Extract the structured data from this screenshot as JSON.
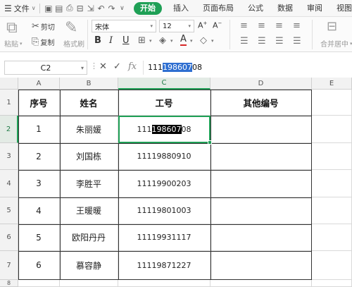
{
  "menubar": {
    "file_label": "文件",
    "tabs": [
      {
        "label": "开始",
        "active": true
      },
      {
        "label": "插入",
        "active": false
      },
      {
        "label": "页面布局",
        "active": false
      },
      {
        "label": "公式",
        "active": false
      },
      {
        "label": "数据",
        "active": false
      },
      {
        "label": "审阅",
        "active": false
      },
      {
        "label": "视图",
        "active": false
      }
    ]
  },
  "ribbon": {
    "cut_label": "剪切",
    "copy_label": "复制",
    "format_painter_label": "格式刷",
    "paste_label": "粘贴",
    "font_name": "宋体",
    "font_size": "12",
    "merge_label": "合并居中"
  },
  "formula_bar": {
    "name_box": "C2",
    "value_prefix": "111",
    "value_selected": "198607",
    "value_suffix": "08"
  },
  "columns": [
    "A",
    "B",
    "C",
    "D",
    "E"
  ],
  "rows": [
    "1",
    "2",
    "3",
    "4",
    "5",
    "6",
    "7",
    "8"
  ],
  "table": {
    "headers": [
      "序号",
      "姓名",
      "工号",
      "其他编号"
    ],
    "data": [
      {
        "no": "1",
        "name": "朱丽媛",
        "id": ""
      },
      {
        "no": "2",
        "name": "刘国栋",
        "id": "11119880910"
      },
      {
        "no": "3",
        "name": "李胜平",
        "id": "11119900203"
      },
      {
        "no": "4",
        "name": "王暖暖",
        "id": "11119801003"
      },
      {
        "no": "5",
        "name": "欧阳丹丹",
        "id": "11119931117"
      },
      {
        "no": "6",
        "name": "慕容静",
        "id": "11119871227"
      }
    ],
    "editing": {
      "prefix": "111",
      "selected": "198607",
      "suffix": "08"
    }
  },
  "colors": {
    "accent": "#1fa056",
    "selection_blue": "#2f6fd1"
  }
}
